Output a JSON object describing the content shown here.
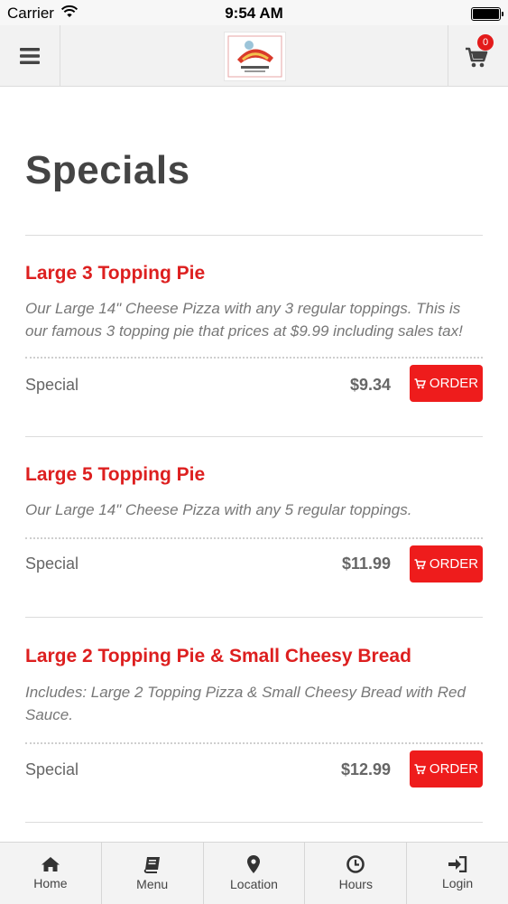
{
  "status_bar": {
    "carrier": "Carrier",
    "time": "9:54 AM"
  },
  "header": {
    "cart_count": "0",
    "icons": {
      "menu": "hamburger-icon",
      "cart": "cart-icon",
      "logo": "restaurant-logo"
    }
  },
  "page": {
    "title": "Specials"
  },
  "items": [
    {
      "title": "Large 3 Topping Pie",
      "description": "Our Large 14\" Cheese Pizza with any 3 regular toppings. This is our famous 3 topping pie that prices at $9.99 including sales tax!",
      "label": "Special",
      "price": "$9.34",
      "order_label": "ORDER"
    },
    {
      "title": "Large 5 Topping Pie",
      "description": "Our Large 14\" Cheese Pizza with any 5 regular toppings.",
      "label": "Special",
      "price": "$11.99",
      "order_label": "ORDER"
    },
    {
      "title": "Large 2 Topping Pie & Small Cheesy Bread",
      "description": "Includes: Large 2 Topping Pizza & Small Cheesy Bread with Red Sauce.",
      "label": "Special",
      "price": "$12.99",
      "order_label": "ORDER"
    }
  ],
  "nav": [
    {
      "label": "Home",
      "icon": "home-icon"
    },
    {
      "label": "Menu",
      "icon": "book-icon"
    },
    {
      "label": "Location",
      "icon": "map-pin-icon"
    },
    {
      "label": "Hours",
      "icon": "clock-icon"
    },
    {
      "label": "Login",
      "icon": "login-icon"
    }
  ],
  "colors": {
    "accent": "#ee1c1c",
    "title_red": "#dd1f1f"
  }
}
